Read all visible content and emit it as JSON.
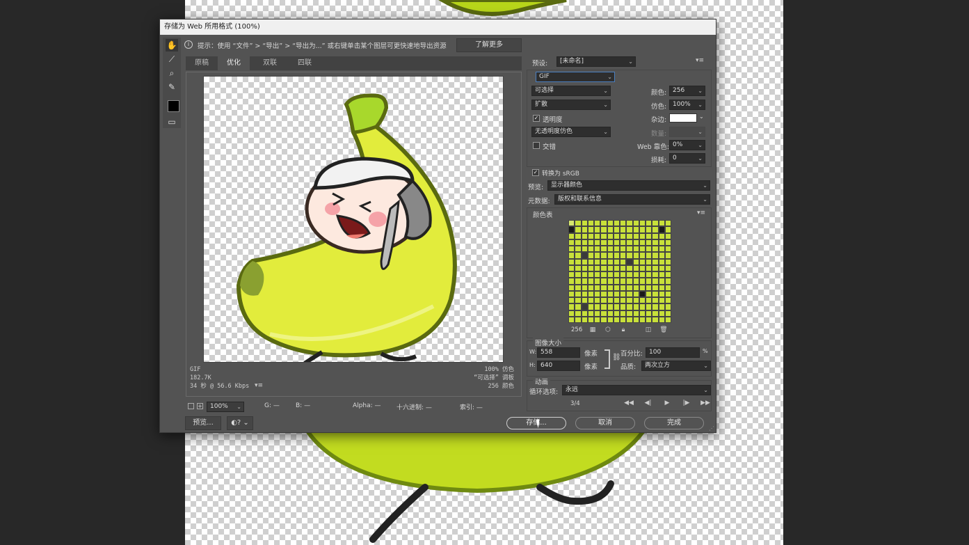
{
  "dialog": {
    "title": "存储为 Web 所用格式 (100%)",
    "hint": "提示：使用 “文件” > “导出” > “导出为...” 或右键单击某个图层可更快速地导出资源",
    "learn_more": "了解更多"
  },
  "tabs": [
    "原稿",
    "优化",
    "双联",
    "四联"
  ],
  "preview_status": {
    "format": "GIF",
    "size": "182.7K",
    "time": "34 秒 @ 56.6 Kbps",
    "dither": "100% 仿色",
    "palette": "“可选择” 调板",
    "colors": "256 颜色"
  },
  "bottom_bar": {
    "zoom": "100%",
    "g": "G: —",
    "b": "B: —",
    "alpha": "Alpha: —",
    "hex": "十六进制: —",
    "index": "索引: —"
  },
  "footer": {
    "preview": "预览...",
    "save": "存储...",
    "cancel": "取消",
    "done": "完成"
  },
  "settings": {
    "preset_label": "预设:",
    "preset_value": "[未命名]",
    "format": "GIF",
    "reduction": "可选择",
    "dither_algo": "扩散",
    "transparency": "透明度",
    "transparency_checked": true,
    "trans_dither": "无透明度仿色",
    "interlaced": "交错",
    "interlaced_checked": false,
    "colors_label": "颜色:",
    "colors_value": "256",
    "dither_label": "仿色:",
    "dither_value": "100%",
    "matte_label": "杂边:",
    "amount_label": "数量:",
    "web_snap_label": "Web 靠色:",
    "web_snap_value": "0%",
    "lossy_label": "损耗:",
    "lossy_value": "0",
    "convert_srgb": "转换为 sRGB",
    "convert_srgb_checked": true,
    "preview_label": "预览:",
    "preview_value": "显示器颜色",
    "metadata_label": "元数据:",
    "metadata_value": "版权和联系信息"
  },
  "color_table": {
    "title": "颜色表",
    "count": "256"
  },
  "image_size": {
    "title": "图像大小",
    "w_label": "W:",
    "w_value": "558",
    "h_label": "H:",
    "h_value": "640",
    "unit": "像素",
    "percent_label": "百分比:",
    "percent_value": "100",
    "percent_unit": "%",
    "quality_label": "品质:",
    "quality_value": "两次立方"
  },
  "animation": {
    "title": "动画",
    "loop_label": "循环选项:",
    "loop_value": "永远",
    "frame": "3/4"
  }
}
